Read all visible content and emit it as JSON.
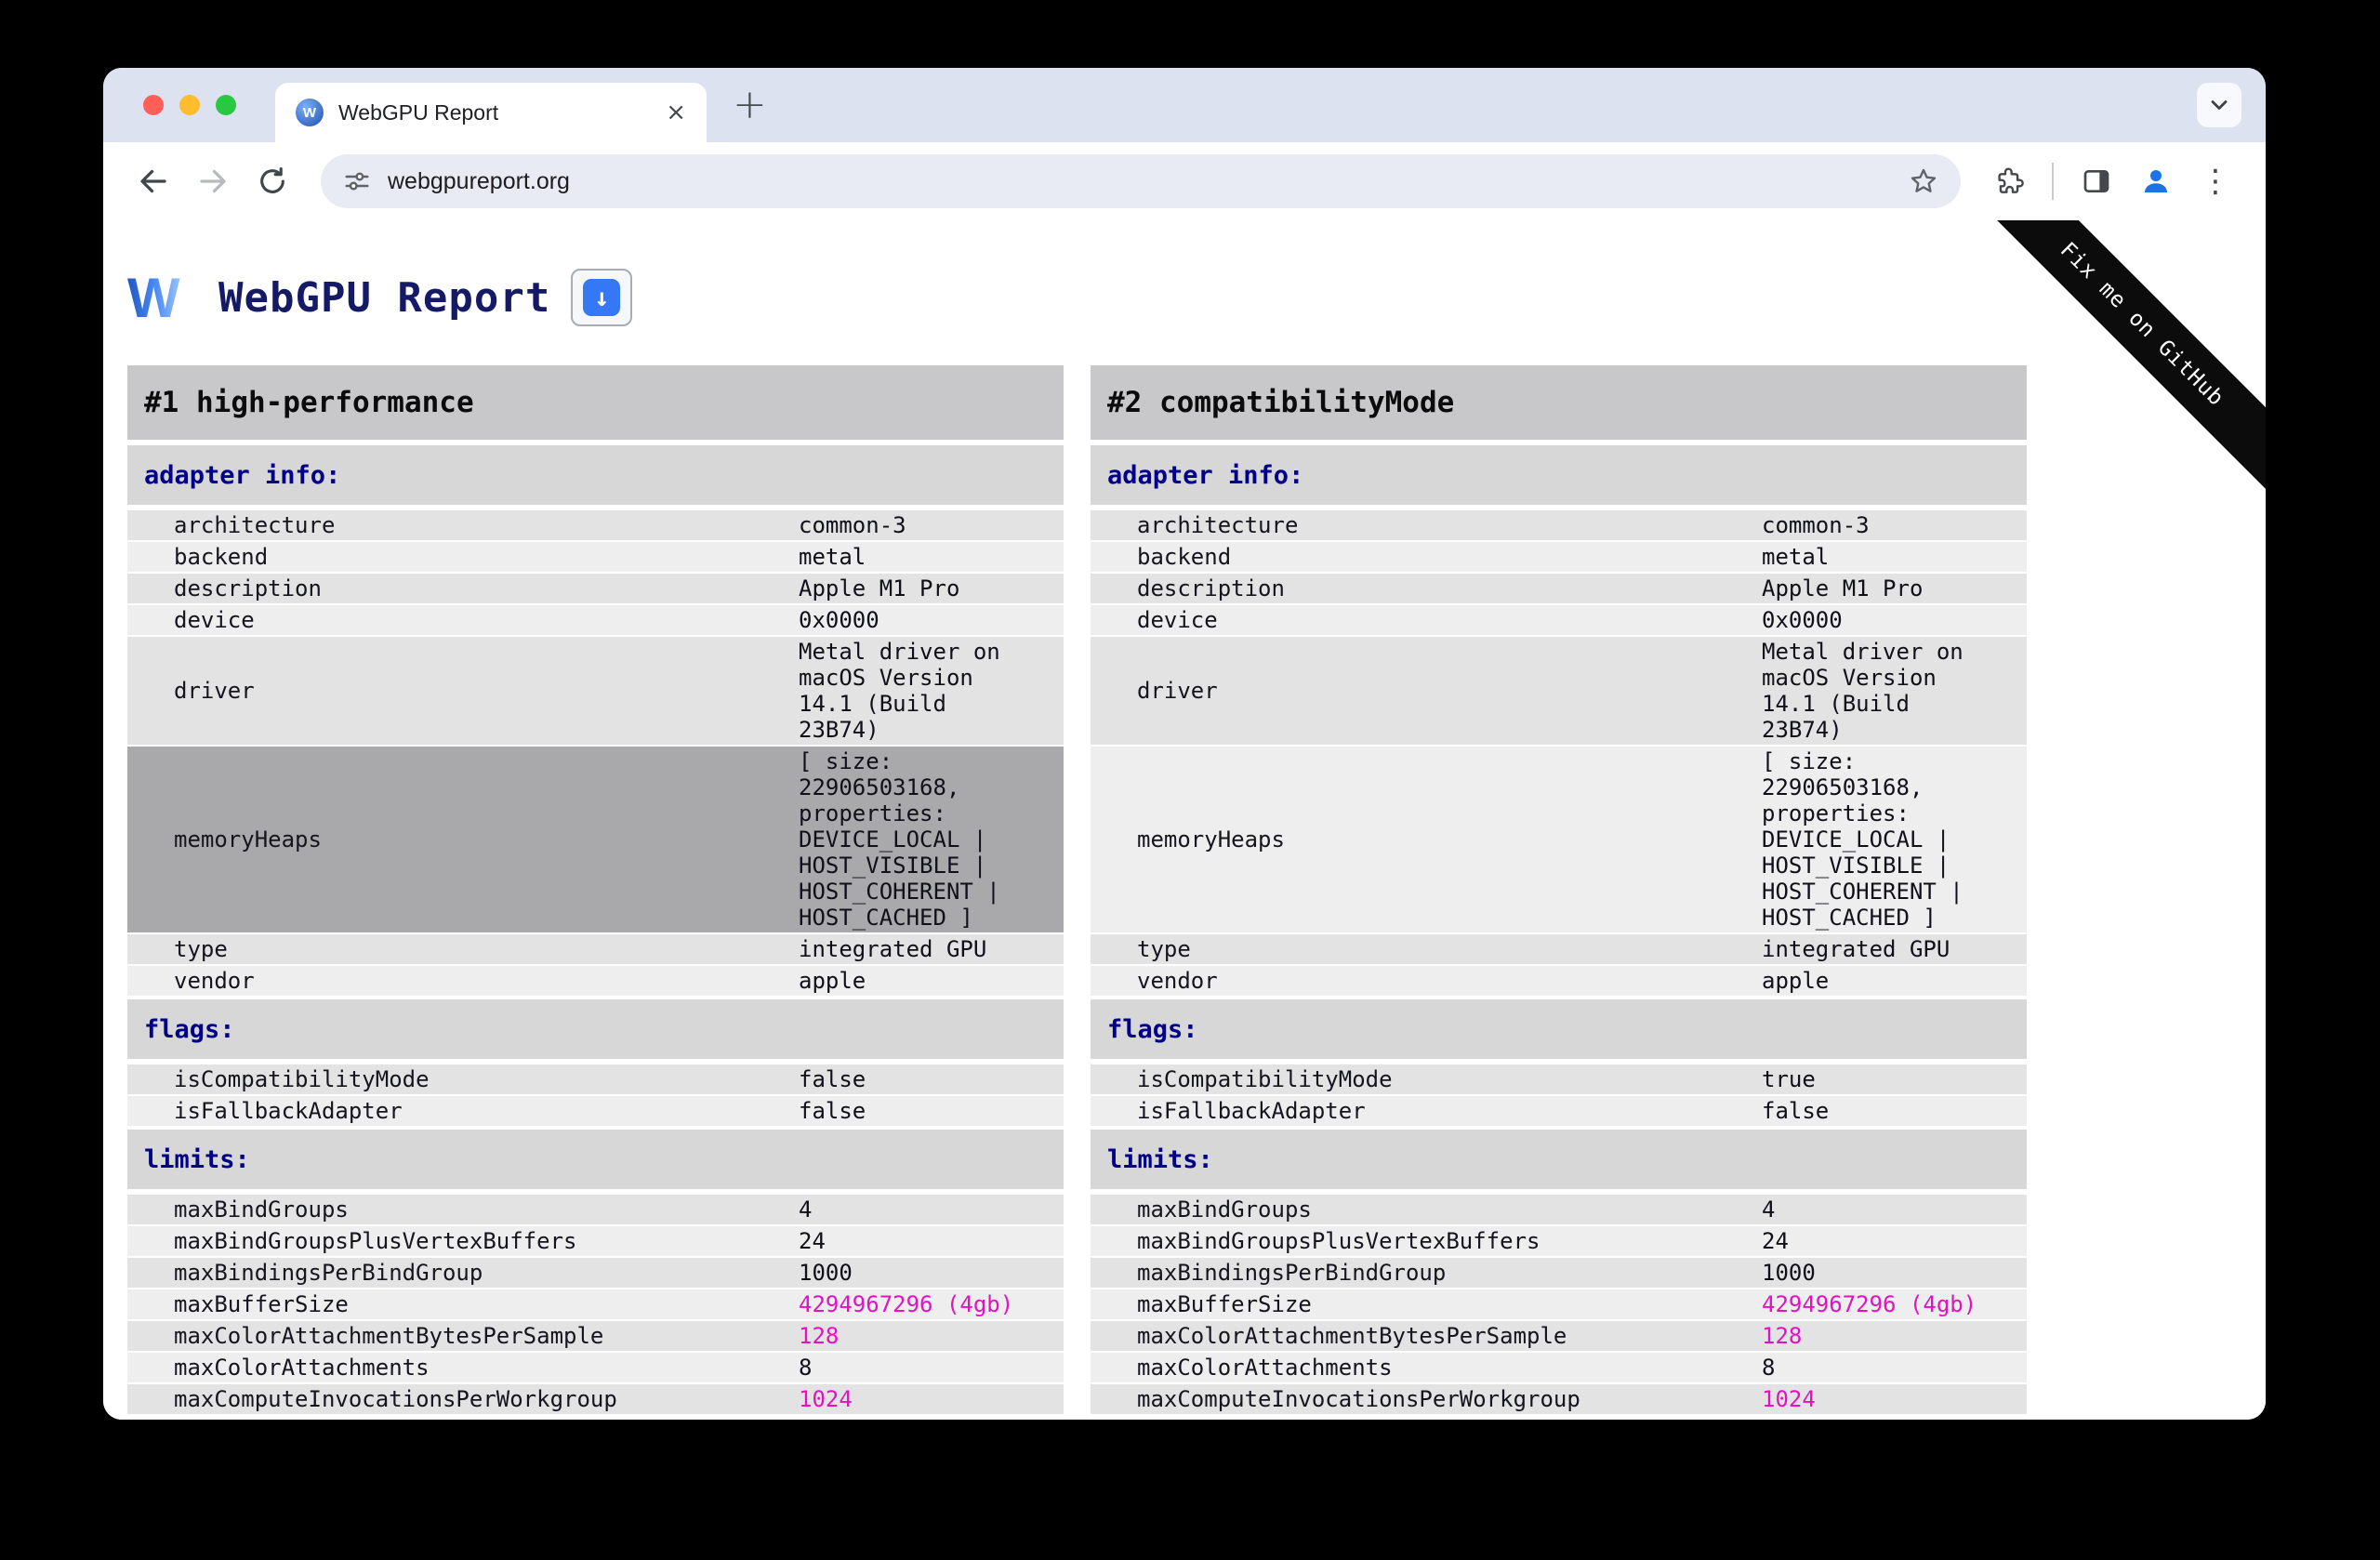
{
  "browser": {
    "tab_title": "WebGPU Report",
    "url": "webgpureport.org",
    "close_glyph": "×",
    "new_tab_glyph": "+",
    "menu_glyph": "⋮"
  },
  "page": {
    "title": "WebGPU Report",
    "logo_letter": "W",
    "download_glyph": "↓",
    "ribbon_label": "Fix me on GitHub"
  },
  "colors": {
    "accent_pink": "#e211c2",
    "section_header_blue": "#00008b"
  },
  "adapters": [
    {
      "title": "#1 high-performance",
      "sections": [
        {
          "header": "adapter info:",
          "rows": [
            {
              "k": "architecture",
              "v": "common-3"
            },
            {
              "k": "backend",
              "v": "metal"
            },
            {
              "k": "description",
              "v": "Apple M1 Pro"
            },
            {
              "k": "device",
              "v": "0x0000"
            },
            {
              "k": "driver",
              "v": "Metal driver on\nmacOS Version\n14.1 (Build\n23B74)"
            },
            {
              "k": "memoryHeaps",
              "v": "[ size:\n22906503168,\nproperties:\nDEVICE_LOCAL |\nHOST_VISIBLE |\nHOST_COHERENT |\nHOST_CACHED ]",
              "hl": true
            },
            {
              "k": "type",
              "v": "integrated GPU"
            },
            {
              "k": "vendor",
              "v": "apple"
            }
          ]
        },
        {
          "header": "flags:",
          "rows": [
            {
              "k": "isCompatibilityMode",
              "v": "false"
            },
            {
              "k": "isFallbackAdapter",
              "v": "false"
            }
          ]
        },
        {
          "header": "limits:",
          "rows": [
            {
              "k": "maxBindGroups",
              "v": "4"
            },
            {
              "k": "maxBindGroupsPlusVertexBuffers",
              "v": "24"
            },
            {
              "k": "maxBindingsPerBindGroup",
              "v": "1000"
            },
            {
              "k": "maxBufferSize",
              "v": "4294967296 (4gb)",
              "pink": true
            },
            {
              "k": "maxColorAttachmentBytesPerSample",
              "v": "128",
              "pink": true
            },
            {
              "k": "maxColorAttachments",
              "v": "8"
            },
            {
              "k": "maxComputeInvocationsPerWorkgroup",
              "v": "1024",
              "pink": true
            }
          ]
        }
      ]
    },
    {
      "title": "#2 compatibilityMode",
      "sections": [
        {
          "header": "adapter info:",
          "rows": [
            {
              "k": "architecture",
              "v": "common-3"
            },
            {
              "k": "backend",
              "v": "metal"
            },
            {
              "k": "description",
              "v": "Apple M1 Pro"
            },
            {
              "k": "device",
              "v": "0x0000"
            },
            {
              "k": "driver",
              "v": "Metal driver on\nmacOS Version\n14.1 (Build\n23B74)"
            },
            {
              "k": "memoryHeaps",
              "v": "[ size:\n22906503168,\nproperties:\nDEVICE_LOCAL |\nHOST_VISIBLE |\nHOST_COHERENT |\nHOST_CACHED ]"
            },
            {
              "k": "type",
              "v": "integrated GPU"
            },
            {
              "k": "vendor",
              "v": "apple"
            }
          ]
        },
        {
          "header": "flags:",
          "rows": [
            {
              "k": "isCompatibilityMode",
              "v": "true"
            },
            {
              "k": "isFallbackAdapter",
              "v": "false"
            }
          ]
        },
        {
          "header": "limits:",
          "rows": [
            {
              "k": "maxBindGroups",
              "v": "4"
            },
            {
              "k": "maxBindGroupsPlusVertexBuffers",
              "v": "24"
            },
            {
              "k": "maxBindingsPerBindGroup",
              "v": "1000"
            },
            {
              "k": "maxBufferSize",
              "v": "4294967296 (4gb)",
              "pink": true
            },
            {
              "k": "maxColorAttachmentBytesPerSample",
              "v": "128",
              "pink": true
            },
            {
              "k": "maxColorAttachments",
              "v": "8"
            },
            {
              "k": "maxComputeInvocationsPerWorkgroup",
              "v": "1024",
              "pink": true
            }
          ]
        }
      ]
    }
  ]
}
